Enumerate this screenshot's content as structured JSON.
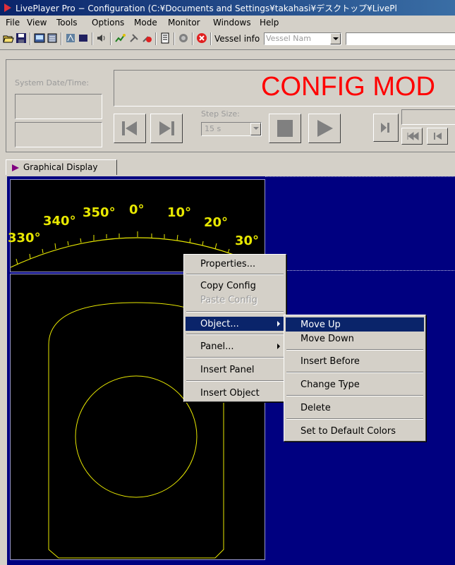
{
  "window": {
    "title": "LivePlayer Pro − Configuration (C:¥Documents and Settings¥takahasi¥デスクトップ¥LivePl"
  },
  "menubar": {
    "items": [
      "File",
      "View",
      "Tools",
      "Options",
      "Mode",
      "Monitor",
      "Windows",
      "Help"
    ]
  },
  "toolbar": {
    "vessel_label": "Vessel info",
    "vessel_placeholder": "Vessel Nam"
  },
  "control_panel": {
    "system_datetime_label": "System Date/Time:",
    "mode_banner": "CONFIG MOD",
    "step_size_label": "Step Size:",
    "step_size_value": "15 s"
  },
  "tabs": {
    "graphical_display": "Graphical Display"
  },
  "compass": {
    "labels": [
      "330°",
      "340°",
      "350°",
      "0°",
      "10°",
      "20°",
      "30°"
    ]
  },
  "context_menu": {
    "items": [
      "Properties...",
      "Copy Config",
      "Paste Config",
      "Object...",
      "Panel...",
      "Insert Panel",
      "Insert Object"
    ]
  },
  "submenu": {
    "items": [
      "Move Up",
      "Move Down",
      "Insert Before",
      "Change Type",
      "Delete",
      "Set to Default Colors"
    ]
  },
  "colors": {
    "title_bar": "#0a246a",
    "banner_text": "#ff0000",
    "display_bg": "#000080",
    "compass_yellow": "#e8e800",
    "highlight": "#0a246a"
  }
}
